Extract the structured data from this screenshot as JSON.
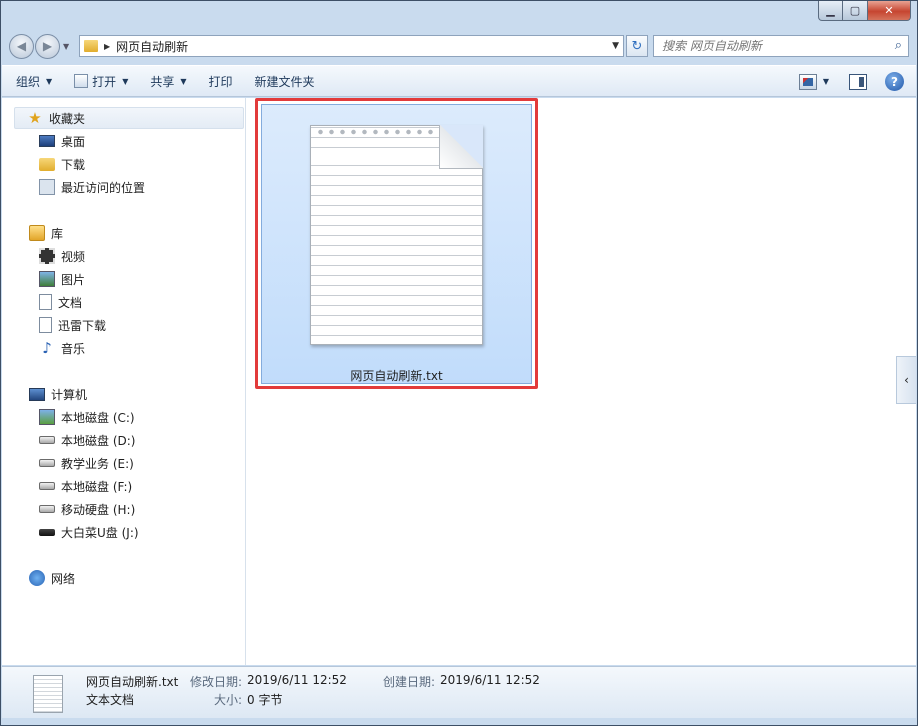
{
  "window": {
    "caption": {
      "minimize": "▁",
      "maximize": "▢",
      "close": "✕"
    }
  },
  "navbar": {
    "back": "◀",
    "forward": "▶",
    "breadcrumb_sep": "▶",
    "breadcrumb": "网页自动刷新",
    "search_placeholder": "搜索 网页自动刷新",
    "refresh": "↻",
    "search_icon": "⌕"
  },
  "toolbar": {
    "organize": "组织",
    "open": "打开",
    "share": "共享",
    "print": "打印",
    "new_folder": "新建文件夹",
    "dropdown": "▼"
  },
  "sidebar": {
    "favorites": {
      "label": "收藏夹",
      "items": [
        "桌面",
        "下载",
        "最近访问的位置"
      ]
    },
    "libraries": {
      "label": "库",
      "items": [
        "视频",
        "图片",
        "文档",
        "迅雷下载",
        "音乐"
      ]
    },
    "computer": {
      "label": "计算机",
      "items": [
        "本地磁盘 (C:)",
        "本地磁盘 (D:)",
        "教学业务 (E:)",
        "本地磁盘 (F:)",
        "移动硬盘 (H:)",
        "大白菜U盘 (J:)"
      ]
    },
    "network": {
      "label": "网络"
    }
  },
  "content": {
    "file_name": "网页自动刷新.txt",
    "collapse": "‹"
  },
  "details": {
    "file_name": "网页自动刷新.txt",
    "file_type": "文本文档",
    "modified_label": "修改日期:",
    "modified_value": "2019/6/11 12:52",
    "created_label": "创建日期:",
    "created_value": "2019/6/11 12:52",
    "size_label": "大小:",
    "size_value": "0 字节"
  },
  "colors": {
    "highlight": "#e23b3b",
    "selection": "#c1dcfb"
  }
}
